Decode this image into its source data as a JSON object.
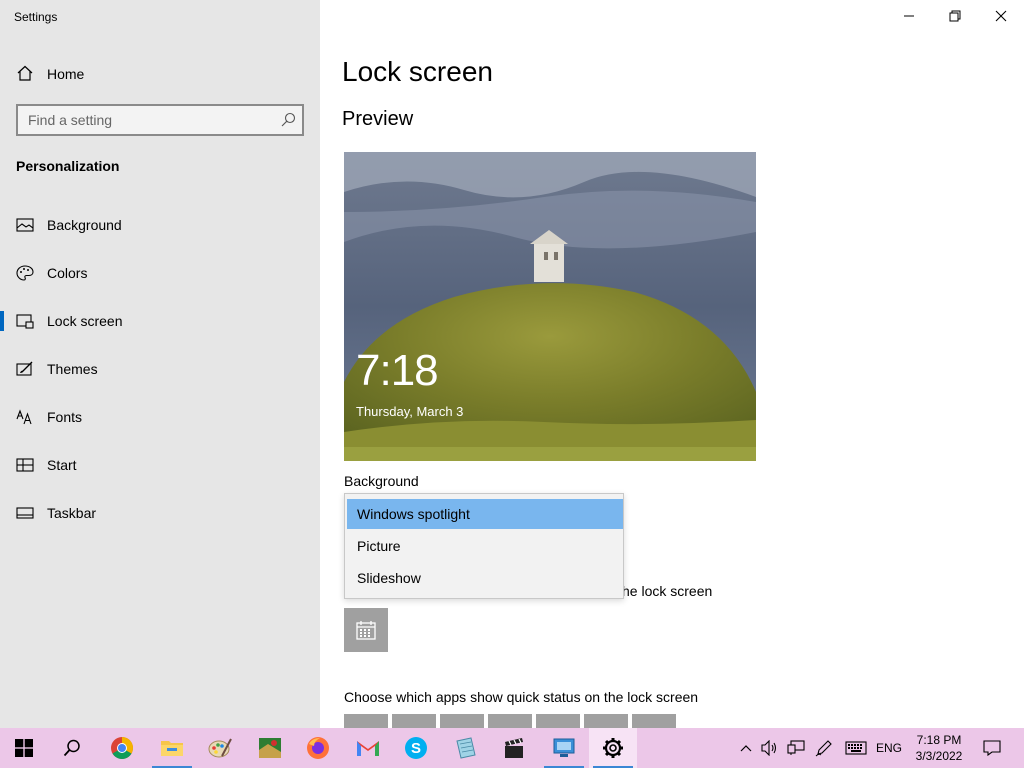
{
  "window": {
    "app_title": "Settings",
    "controls": [
      "minimize-icon",
      "restore-icon",
      "close-icon"
    ]
  },
  "sidebar": {
    "home_label": "Home",
    "search": {
      "placeholder": "Find a setting",
      "value": ""
    },
    "section_title": "Personalization",
    "items": [
      {
        "label": "Background",
        "icon": "background-icon",
        "active": false
      },
      {
        "label": "Colors",
        "icon": "palette-icon",
        "active": false
      },
      {
        "label": "Lock screen",
        "icon": "lock-screen-icon",
        "active": true
      },
      {
        "label": "Themes",
        "icon": "themes-icon",
        "active": false
      },
      {
        "label": "Fonts",
        "icon": "fonts-icon",
        "active": false
      },
      {
        "label": "Start",
        "icon": "start-icon",
        "active": false
      },
      {
        "label": "Taskbar",
        "icon": "taskbar-icon",
        "active": false
      }
    ]
  },
  "main": {
    "title": "Lock screen",
    "preview_title": "Preview",
    "preview": {
      "time": "7:18",
      "date": "Thursday, March 3"
    },
    "background_label": "Background",
    "dropdown_options": [
      {
        "label": "Windows spotlight",
        "selected": true
      },
      {
        "label": "Picture",
        "selected": false
      },
      {
        "label": "Slideshow",
        "selected": false
      }
    ],
    "partially_hidden_text": "he lock screen",
    "detailed_status_icon": "calendar-icon",
    "quick_status_label": "Choose which apps show quick status on the lock screen",
    "quick_status_tiles": 7
  },
  "taskbar": {
    "apps": [
      {
        "name": "start-button",
        "icon": "windows-logo-icon"
      },
      {
        "name": "search-button",
        "icon": "search-icon"
      },
      {
        "name": "chrome",
        "icon": "chrome-icon"
      },
      {
        "name": "file-explorer",
        "icon": "folder-icon",
        "running": true
      },
      {
        "name": "paint",
        "icon": "paint-icon"
      },
      {
        "name": "maps",
        "icon": "maps-icon"
      },
      {
        "name": "firefox",
        "icon": "firefox-icon"
      },
      {
        "name": "gmail",
        "icon": "gmail-icon"
      },
      {
        "name": "skype",
        "icon": "skype-icon"
      },
      {
        "name": "notepad",
        "icon": "notepad-icon"
      },
      {
        "name": "video-editor",
        "icon": "clapperboard-icon"
      },
      {
        "name": "remote-desktop",
        "icon": "remote-desktop-icon",
        "running": true
      },
      {
        "name": "settings",
        "icon": "gear-icon",
        "running": true,
        "active": true
      }
    ],
    "tray": {
      "language": "ENG",
      "time": "7:18 PM",
      "date": "3/3/2022"
    }
  },
  "colors": {
    "sidebar_bg": "#e6e6e6",
    "accent": "#0067c0",
    "dropdown_selected": "#79b6ee",
    "taskbar_bg": "#ecc7e8"
  }
}
